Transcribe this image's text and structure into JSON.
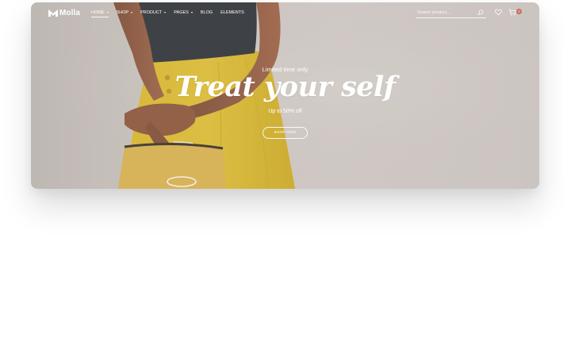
{
  "header": {
    "brand": "Molla",
    "nav": [
      {
        "label": "Home",
        "has_dropdown": true,
        "active": true
      },
      {
        "label": "Shop",
        "has_dropdown": true
      },
      {
        "label": "Product",
        "has_dropdown": true
      },
      {
        "label": "Pages",
        "has_dropdown": true
      },
      {
        "label": "Blog",
        "has_dropdown": false
      },
      {
        "label": "Elements",
        "has_dropdown": false
      }
    ],
    "search_placeholder": "Search product...",
    "cart_count": "0"
  },
  "hero": {
    "eyebrow": "Limited time only",
    "title": "Treat your self",
    "subtitle": "Up to 50% off",
    "button": "Shop Now"
  },
  "colors": {
    "hero_bg": "#c7c0bb",
    "skirt": "#d2b22c",
    "badge": "#c96b5f"
  }
}
